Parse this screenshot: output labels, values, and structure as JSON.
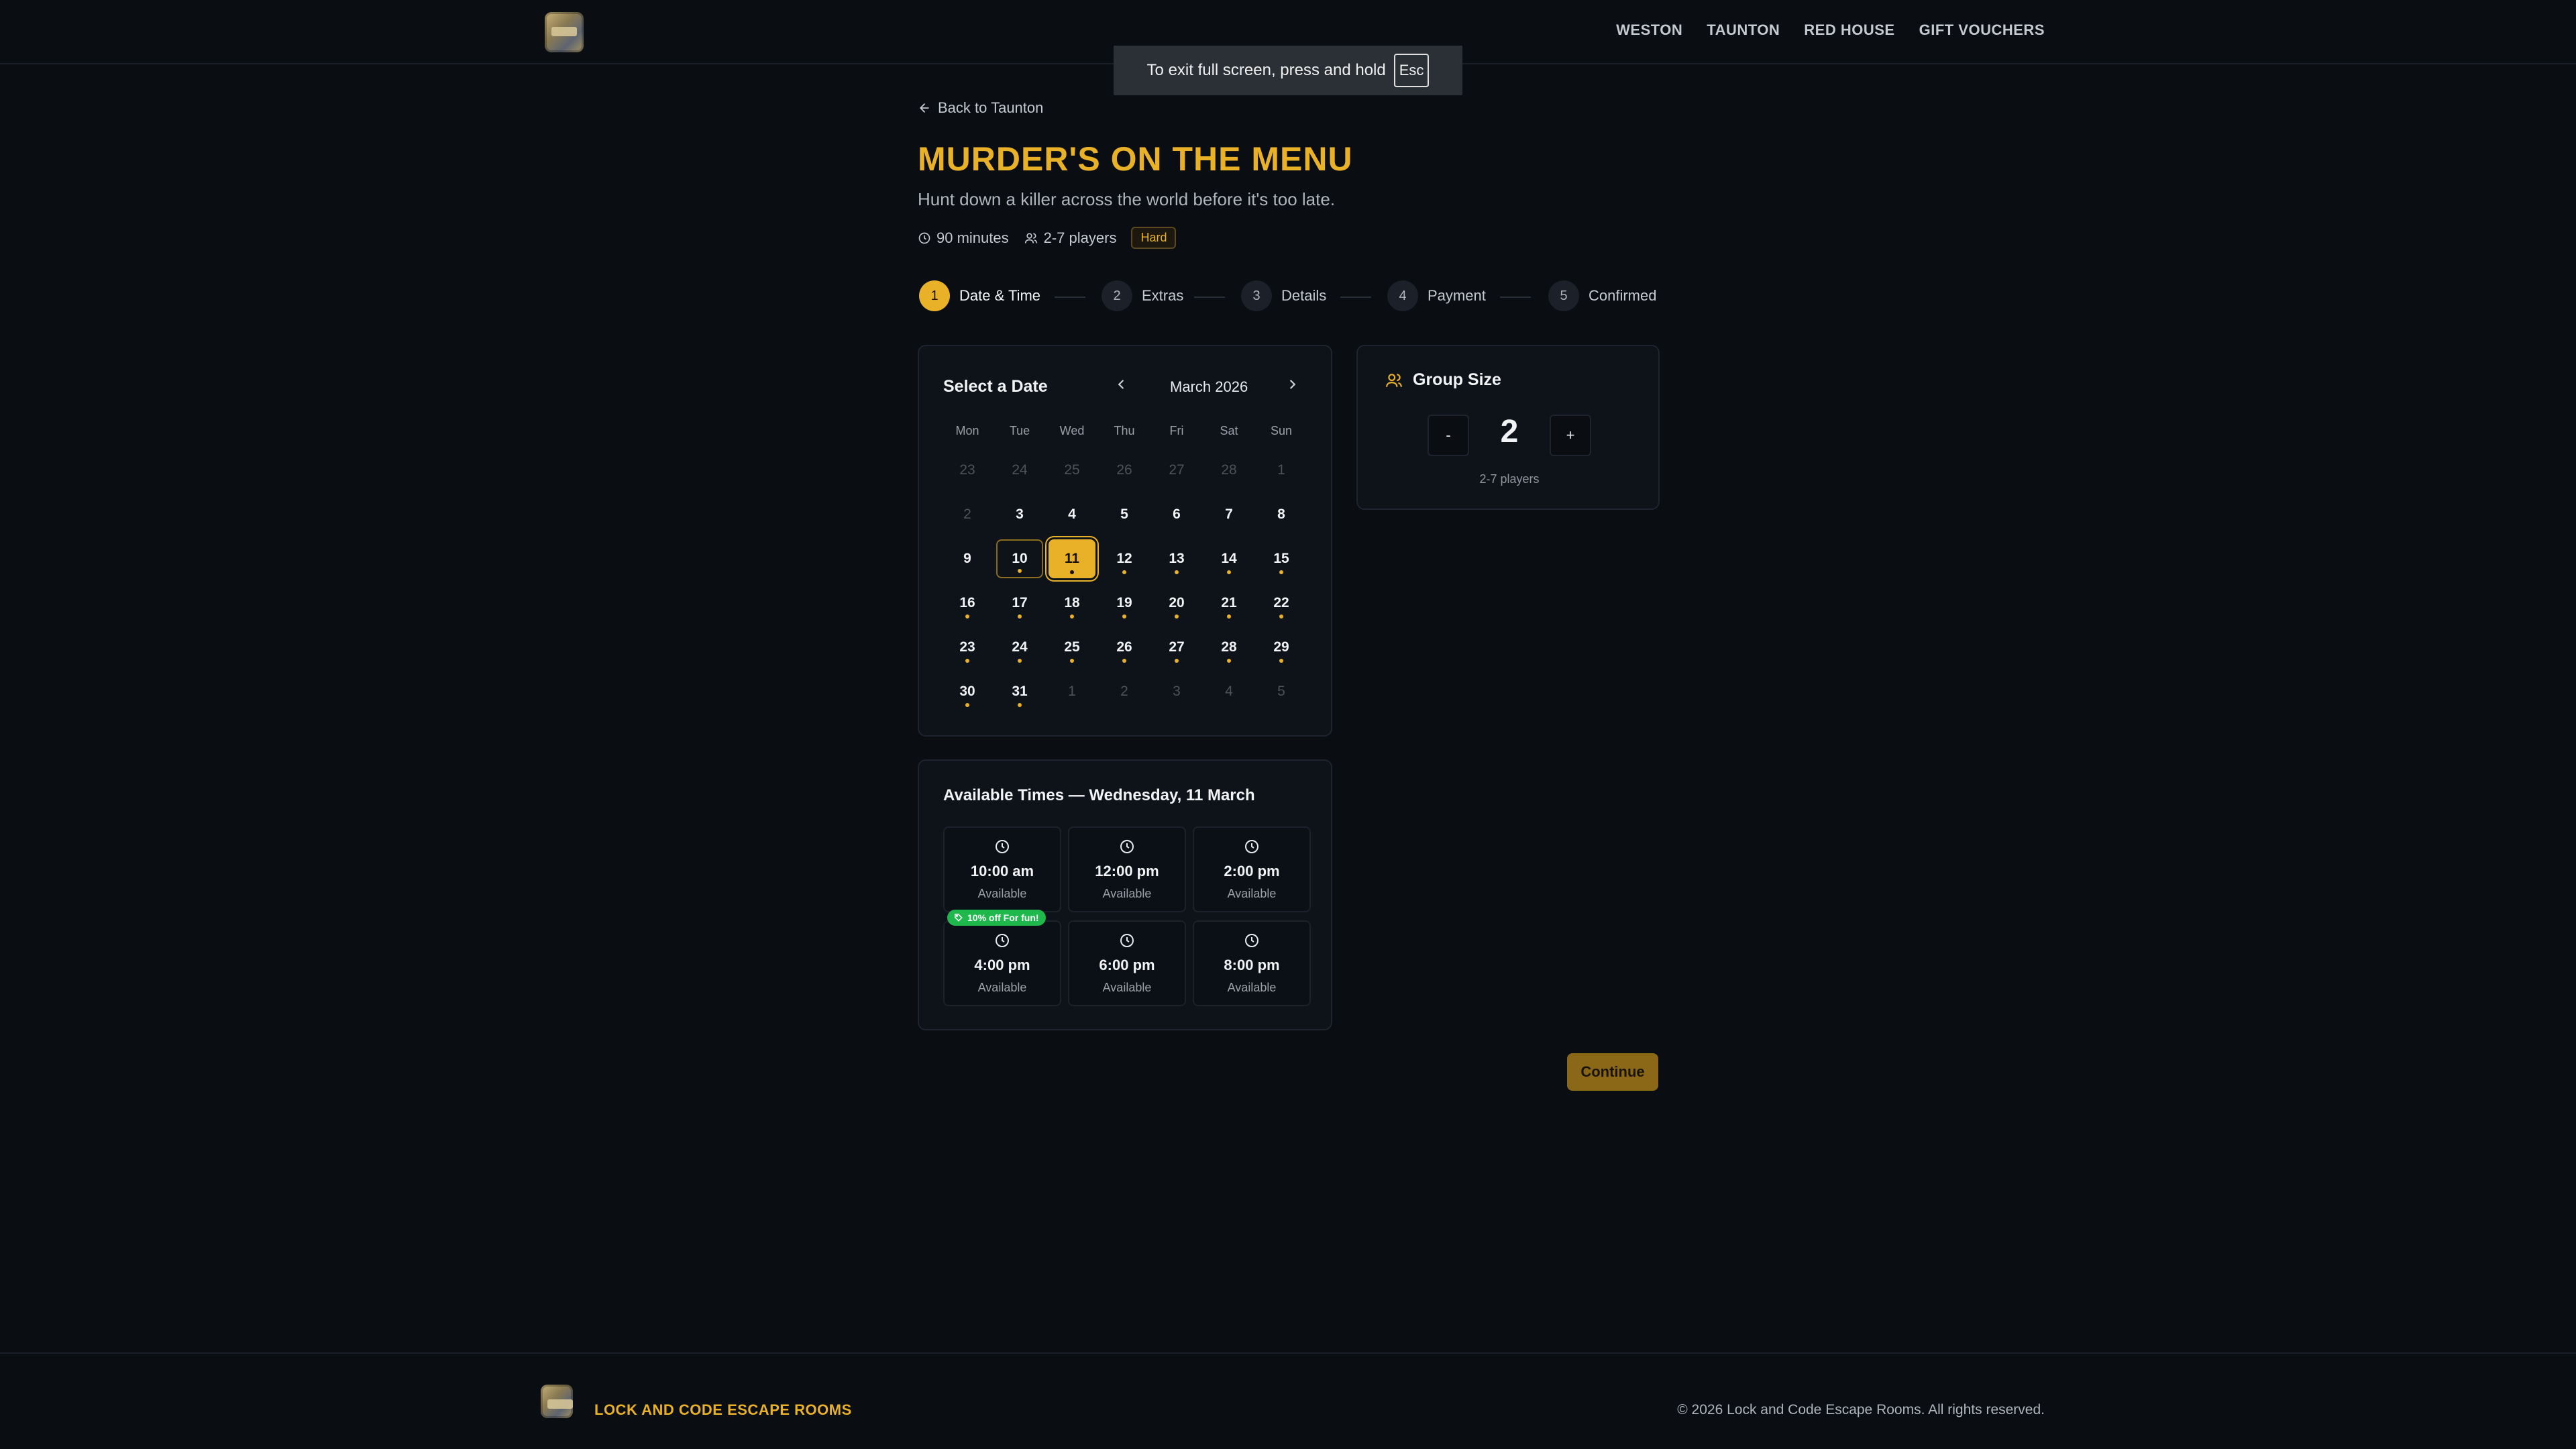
{
  "nav": {
    "items": [
      "WESTON",
      "TAUNTON",
      "RED HOUSE",
      "GIFT VOUCHERS"
    ]
  },
  "fullscreen_toast": {
    "text": "To exit full screen, press and hold",
    "key": "Esc"
  },
  "back_link": "Back to Taunton",
  "room": {
    "title": "MURDER'S ON THE MENU",
    "subtitle": "Hunt down a killer across the world before it's too late.",
    "duration": "90 minutes",
    "players": "2-7 players",
    "difficulty": "Hard"
  },
  "steps": [
    {
      "num": "1",
      "label": "Date & Time",
      "active": true
    },
    {
      "num": "2",
      "label": "Extras",
      "active": false
    },
    {
      "num": "3",
      "label": "Details",
      "active": false
    },
    {
      "num": "4",
      "label": "Payment",
      "active": false
    },
    {
      "num": "5",
      "label": "Confirmed",
      "active": false
    }
  ],
  "calendar": {
    "heading": "Select a Date",
    "month": "March 2026",
    "weekdays": [
      "Mon",
      "Tue",
      "Wed",
      "Thu",
      "Fri",
      "Sat",
      "Sun"
    ],
    "weeks": [
      [
        {
          "d": "23",
          "muted": true
        },
        {
          "d": "24",
          "muted": true
        },
        {
          "d": "25",
          "muted": true
        },
        {
          "d": "26",
          "muted": true
        },
        {
          "d": "27",
          "muted": true
        },
        {
          "d": "28",
          "muted": true
        },
        {
          "d": "1",
          "muted": true
        }
      ],
      [
        {
          "d": "2",
          "muted": true
        },
        {
          "d": "3"
        },
        {
          "d": "4"
        },
        {
          "d": "5"
        },
        {
          "d": "6"
        },
        {
          "d": "7"
        },
        {
          "d": "8"
        }
      ],
      [
        {
          "d": "9"
        },
        {
          "d": "10",
          "dot": true,
          "today": true
        },
        {
          "d": "11",
          "dot": true,
          "selected": true
        },
        {
          "d": "12",
          "dot": true
        },
        {
          "d": "13",
          "dot": true
        },
        {
          "d": "14",
          "dot": true
        },
        {
          "d": "15",
          "dot": true
        }
      ],
      [
        {
          "d": "16",
          "dot": true
        },
        {
          "d": "17",
          "dot": true
        },
        {
          "d": "18",
          "dot": true
        },
        {
          "d": "19",
          "dot": true
        },
        {
          "d": "20",
          "dot": true
        },
        {
          "d": "21",
          "dot": true
        },
        {
          "d": "22",
          "dot": true
        }
      ],
      [
        {
          "d": "23",
          "dot": true
        },
        {
          "d": "24",
          "dot": true
        },
        {
          "d": "25",
          "dot": true
        },
        {
          "d": "26",
          "dot": true
        },
        {
          "d": "27",
          "dot": true
        },
        {
          "d": "28",
          "dot": true
        },
        {
          "d": "29",
          "dot": true
        }
      ],
      [
        {
          "d": "30",
          "dot": true
        },
        {
          "d": "31",
          "dot": true
        },
        {
          "d": "1",
          "muted": true
        },
        {
          "d": "2",
          "muted": true
        },
        {
          "d": "3",
          "muted": true
        },
        {
          "d": "4",
          "muted": true
        },
        {
          "d": "5",
          "muted": true
        }
      ]
    ]
  },
  "group": {
    "heading": "Group Size",
    "minus": "-",
    "plus": "+",
    "count": "2",
    "range": "2-7 players"
  },
  "times": {
    "heading": "Available Times — Wednesday, 11 March",
    "promo": "10% off For fun!",
    "slots": [
      {
        "time": "10:00 am",
        "status": "Available"
      },
      {
        "time": "12:00 pm",
        "status": "Available"
      },
      {
        "time": "2:00 pm",
        "status": "Available"
      },
      {
        "time": "4:00 pm",
        "status": "Available"
      },
      {
        "time": "6:00 pm",
        "status": "Available"
      },
      {
        "time": "8:00 pm",
        "status": "Available"
      }
    ]
  },
  "continue_label": "Continue",
  "footer": {
    "brand": "LOCK AND CODE ESCAPE ROOMS",
    "copyright": "© 2026 Lock and Code Escape Rooms. All rights reserved."
  },
  "colors": {
    "accent": "#e9b127",
    "background": "#0a0d12",
    "card": "#0e131a",
    "promo": "#1fb84d"
  }
}
